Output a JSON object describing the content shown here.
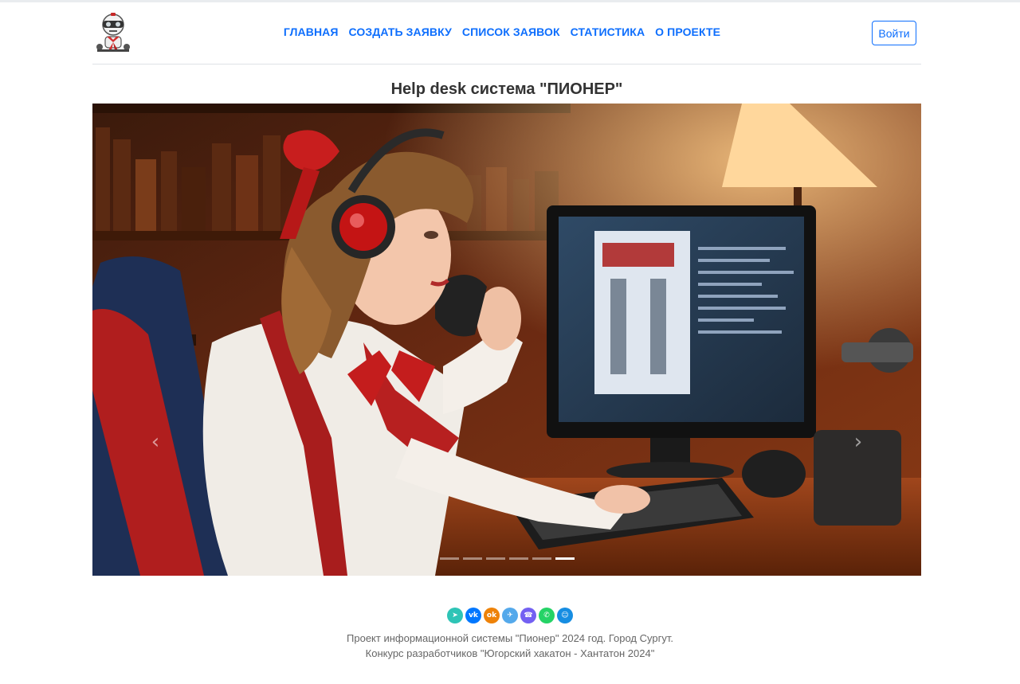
{
  "header": {
    "logo_icon": "robot-pioneer-logo-icon",
    "nav": [
      {
        "label": "ГЛАВНАЯ"
      },
      {
        "label": "СОЗДАТЬ ЗАЯВКУ"
      },
      {
        "label": "СПИСОК ЗАЯВОК"
      },
      {
        "label": "СТАТИСТИКА"
      },
      {
        "label": "О ПРОЕКТЕ"
      }
    ],
    "login_label": "Войти"
  },
  "main": {
    "title": "Help desk система \"ПИОНЕР\"",
    "carousel": {
      "image": "pioneer-girl-helpdesk-operator",
      "slide_count": 6,
      "active_slide": 6,
      "prev_icon": "chevron-left-icon",
      "next_icon": "chevron-right-icon"
    }
  },
  "footer": {
    "socials": [
      {
        "icon": "share-icon",
        "color": "#2ec4b6",
        "glyph": "➤"
      },
      {
        "icon": "vk-icon",
        "color": "#0077ff",
        "glyph": "vk"
      },
      {
        "icon": "odnoklassniki-icon",
        "color": "#ee8208",
        "glyph": "ok"
      },
      {
        "icon": "telegram-icon",
        "color": "#54a9eb",
        "glyph": "✈"
      },
      {
        "icon": "viber-icon",
        "color": "#7360f2",
        "glyph": "☎"
      },
      {
        "icon": "whatsapp-icon",
        "color": "#25d366",
        "glyph": "✆"
      },
      {
        "icon": "moimir-icon",
        "color": "#168de2",
        "glyph": "☺"
      }
    ],
    "line1": "Проект информационной системы \"Пионер\" 2024 год. Город Сургут.",
    "line2": "Конкурс разработчиков \"Югорский хакатон - Хантатон 2024\""
  }
}
